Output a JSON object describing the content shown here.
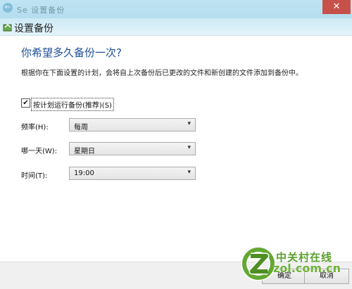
{
  "titlebar": {
    "faded_title": "Se 设置备份",
    "close_glyph": "✕"
  },
  "header": {
    "title": "设置备份"
  },
  "main": {
    "question": "你希望多久备份一次?",
    "description": "根据你在下面设置的计划，会将自上次备份后已更改的文件和新创建的文件添加到备份中。",
    "schedule_checkbox": {
      "label": "按计划运行备份(推荐)(S)",
      "checked": true
    },
    "frequency": {
      "label": "频率(H):",
      "value": "每周"
    },
    "day": {
      "label": "哪一天(W):",
      "value": "星期日"
    },
    "time": {
      "label": "时间(T):",
      "value": "19:00"
    }
  },
  "buttons": {
    "ok": "确定",
    "cancel": "取消"
  },
  "watermark": {
    "brand_cn": "中关村在线",
    "domain": "zol.com.cn"
  },
  "colors": {
    "accent": "#1e4e99",
    "titlebar": "#bfe4f3",
    "close": "#c7514a",
    "watermark": "#5aa02c"
  }
}
